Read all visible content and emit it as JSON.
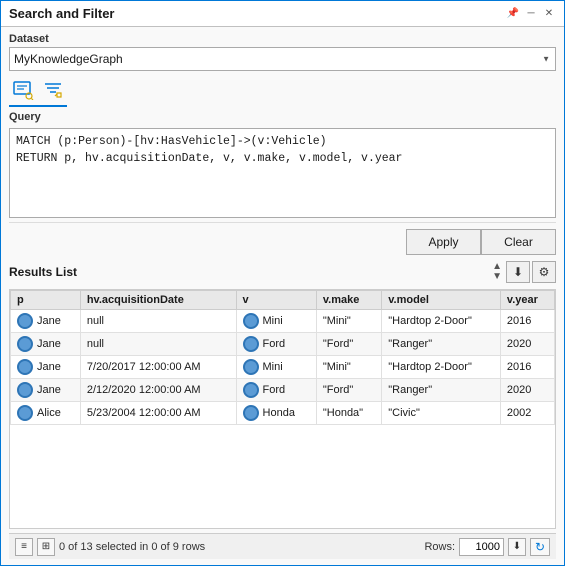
{
  "window": {
    "title": "Search and Filter"
  },
  "title_controls": {
    "pin": "─",
    "minimize": "─",
    "close": "✕"
  },
  "dataset": {
    "label": "Dataset",
    "value": "MyKnowledgeGraph",
    "options": [
      "MyKnowledgeGraph"
    ]
  },
  "toolbar": {
    "icon1_label": "query-icon",
    "icon2_label": "filter-icon"
  },
  "query": {
    "label": "Query",
    "value": "MATCH (p:Person)-[hv:HasVehicle]->(v:Vehicle)\nRETURN p, hv.acquisitionDate, v, v.make, v.model, v.year"
  },
  "buttons": {
    "apply": "Apply",
    "clear": "Clear"
  },
  "results": {
    "label": "Results List",
    "columns": [
      "p",
      "hv.acquisitionDate",
      "v",
      "v.make",
      "v.model",
      "v.year"
    ],
    "rows": [
      {
        "p": "Jane",
        "hv_acquisitionDate": "null",
        "v": "Mini",
        "v_make": "\"Mini\"",
        "v_model": "\"Hardtop 2-Door\"",
        "v_year": "2016"
      },
      {
        "p": "Jane",
        "hv_acquisitionDate": "null",
        "v": "Ford",
        "v_make": "\"Ford\"",
        "v_model": "\"Ranger\"",
        "v_year": "2020"
      },
      {
        "p": "Jane",
        "hv_acquisitionDate": "7/20/2017 12:00:00 AM",
        "v": "Mini",
        "v_make": "\"Mini\"",
        "v_model": "\"Hardtop 2-Door\"",
        "v_year": "2016"
      },
      {
        "p": "Jane",
        "hv_acquisitionDate": "2/12/2020 12:00:00 AM",
        "v": "Ford",
        "v_make": "\"Ford\"",
        "v_model": "\"Ranger\"",
        "v_year": "2020"
      },
      {
        "p": "Alice",
        "hv_acquisitionDate": "5/23/2004 12:00:00 AM",
        "v": "Honda",
        "v_make": "\"Honda\"",
        "v_model": "\"Civic\"",
        "v_year": "2002"
      }
    ]
  },
  "status": {
    "text": "0 of 13 selected in 0 of 9 rows",
    "rows_label": "Rows:",
    "rows_value": "1000"
  }
}
